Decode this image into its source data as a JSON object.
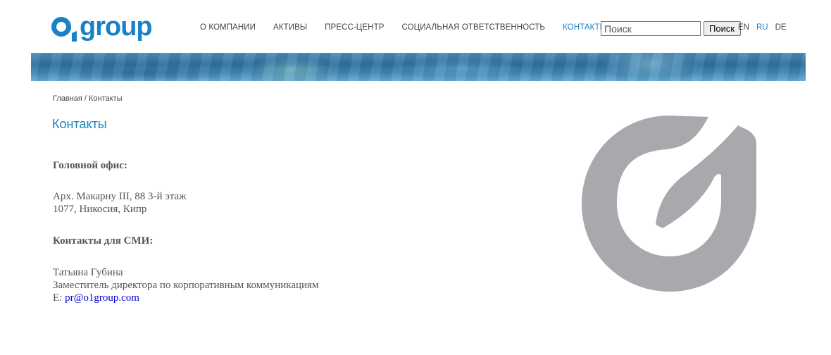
{
  "brand": {
    "name": "o1group",
    "color": "#1a82c4"
  },
  "nav": {
    "items": [
      {
        "label": "О КОМПАНИИ",
        "active": false
      },
      {
        "label": "АКТИВЫ",
        "active": false
      },
      {
        "label": "ПРЕСС-ЦЕНТР",
        "active": false
      },
      {
        "label": "СОЦИАЛЬНАЯ ОТВЕТСТВЕННОСТЬ",
        "active": false
      },
      {
        "label": "КОНТАКТЫ",
        "active": true
      }
    ]
  },
  "search": {
    "placeholder": "Поиск",
    "button_label": "Поиск"
  },
  "languages": [
    {
      "label": "EN",
      "active": false
    },
    {
      "label": "RU",
      "active": true
    },
    {
      "label": "DE",
      "active": false
    }
  ],
  "breadcrumb": {
    "home": "Главная",
    "separator": " / ",
    "current": "Контакты"
  },
  "page": {
    "title": "Контакты"
  },
  "office": {
    "heading": "Головной офис:",
    "address_line1": "Арх. Макарну III, 88 3-й этаж",
    "address_line2": "1077, Никосия, Кипр"
  },
  "media": {
    "heading": "Контакты для СМИ:",
    "name": "Татьяна Губина",
    "position": "Заместитель директора по корпоративным коммуникациям",
    "email_prefix": "E: ",
    "email": "pr@o1group.com"
  },
  "colors": {
    "accent": "#1a82c4",
    "text": "#555555",
    "logo_gray": "#a7a9ac",
    "link": "#0000dd"
  }
}
